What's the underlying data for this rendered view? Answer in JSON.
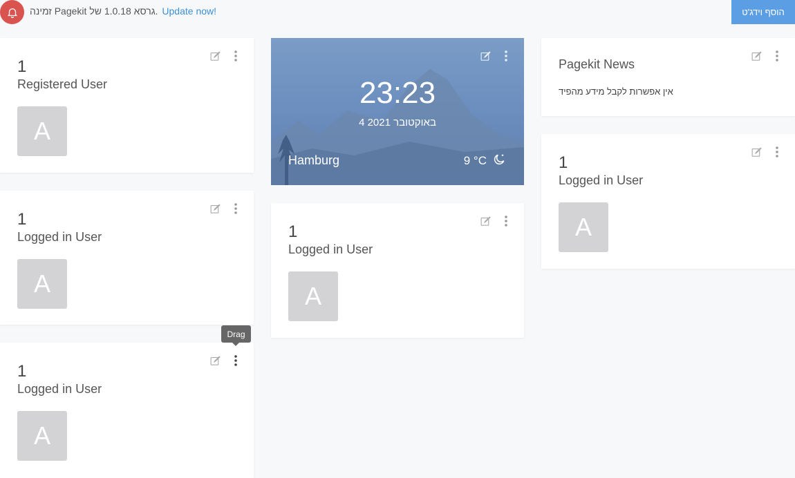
{
  "notice": {
    "text": "זמינה Pagekit גרסא 1.0.18 של.",
    "update_link": "Update now!"
  },
  "toolbar": {
    "add_widget_label": "הוסף וידג'ט"
  },
  "icons": {
    "edit": "edit-icon",
    "more": "more-vertical-icon",
    "bell": "bell-icon",
    "moon": "moon-icon"
  },
  "colors": {
    "accent": "#5b9ee4",
    "alert": "#d9534f",
    "avatar": "#d3d3d6"
  },
  "widgets": {
    "registered": {
      "count": "1",
      "label": "Registered User",
      "avatar": "A"
    },
    "logged_left": {
      "count": "1",
      "label": "Logged in User",
      "avatar": "A"
    },
    "logged_left2": {
      "count": "1",
      "label": "Logged in User",
      "avatar": "A"
    },
    "logged_middle": {
      "count": "1",
      "label": "Logged in User",
      "avatar": "A"
    },
    "logged_right": {
      "count": "1",
      "label": "Logged in User",
      "avatar": "A"
    },
    "clock": {
      "time": "23:23",
      "date": "4 באוקטובר 2021",
      "city": "Hamburg",
      "temperature": "9 °C"
    },
    "news": {
      "title": "Pagekit News",
      "message": "אין אפשרות לקבל מידע מהפיד"
    }
  },
  "tooltip": {
    "label": "Drag"
  }
}
